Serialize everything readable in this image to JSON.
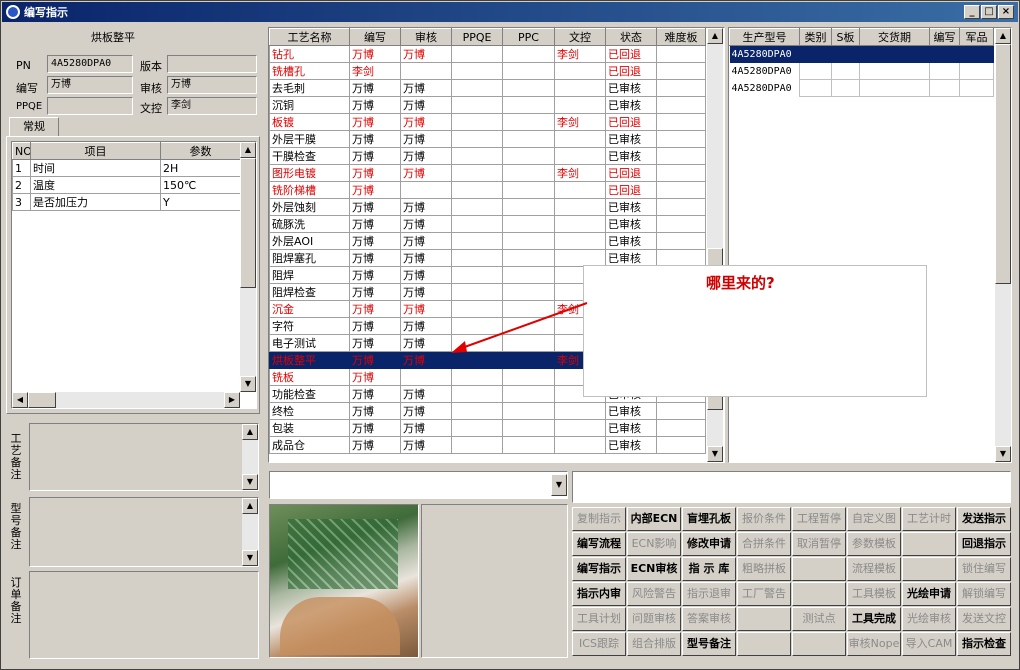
{
  "window": {
    "title": "编写指示",
    "min": "_",
    "max": "□",
    "close": "×"
  },
  "left": {
    "header": "烘板整平",
    "pn_label": "PN",
    "pn": "4A5280DPA0",
    "version_label": "版本",
    "version": "",
    "writer_label": "编写",
    "writer": "万博",
    "reviewer_label": "审核",
    "reviewer": "万博",
    "ppqe_label": "PPQE",
    "ppqe": "",
    "doc_label": "文控",
    "doc": "李剑",
    "tab": "常规",
    "params_headers": [
      "NO",
      "项目",
      "参数"
    ],
    "params": [
      {
        "no": "1",
        "item": "时间",
        "value": "2H"
      },
      {
        "no": "2",
        "item": "温度",
        "value": "150℃"
      },
      {
        "no": "3",
        "item": "是否加压力",
        "value": "Y"
      }
    ],
    "notes": [
      {
        "label": "工艺备注"
      },
      {
        "label": "型号备注"
      },
      {
        "label": "订单备注"
      }
    ]
  },
  "process": {
    "headers": [
      "工艺名称",
      "编写",
      "审核",
      "PPQE",
      "PPC",
      "文控",
      "状态",
      "难度板"
    ],
    "rows": [
      {
        "name": "钻孔",
        "writer": "万博",
        "reviewer": "万博",
        "ppqe": "",
        "ppc": "",
        "doc": "李剑",
        "status": "已回退",
        "hard": "",
        "red": true
      },
      {
        "name": "铣槽孔",
        "writer": "李剑",
        "reviewer": "",
        "ppqe": "",
        "ppc": "",
        "doc": "",
        "status": "已回退",
        "hard": "",
        "red": true
      },
      {
        "name": "去毛刺",
        "writer": "万博",
        "reviewer": "万博",
        "ppqe": "",
        "ppc": "",
        "doc": "",
        "status": "已审核",
        "hard": "",
        "red": false
      },
      {
        "name": "沉铜",
        "writer": "万博",
        "reviewer": "万博",
        "ppqe": "",
        "ppc": "",
        "doc": "",
        "status": "已审核",
        "hard": "",
        "red": false
      },
      {
        "name": "板镀",
        "writer": "万博",
        "reviewer": "万博",
        "ppqe": "",
        "ppc": "",
        "doc": "李剑",
        "status": "已回退",
        "hard": "",
        "red": true
      },
      {
        "name": "外层干膜",
        "writer": "万博",
        "reviewer": "万博",
        "ppqe": "",
        "ppc": "",
        "doc": "",
        "status": "已审核",
        "hard": "",
        "red": false
      },
      {
        "name": "干膜检查",
        "writer": "万博",
        "reviewer": "万博",
        "ppqe": "",
        "ppc": "",
        "doc": "",
        "status": "已审核",
        "hard": "",
        "red": false
      },
      {
        "name": "图形电镀",
        "writer": "万博",
        "reviewer": "万博",
        "ppqe": "",
        "ppc": "",
        "doc": "李剑",
        "status": "已回退",
        "hard": "",
        "red": true
      },
      {
        "name": "铣阶梯槽",
        "writer": "万博",
        "reviewer": "",
        "ppqe": "",
        "ppc": "",
        "doc": "",
        "status": "已回退",
        "hard": "",
        "red": true
      },
      {
        "name": "外层蚀刻",
        "writer": "万博",
        "reviewer": "万博",
        "ppqe": "",
        "ppc": "",
        "doc": "",
        "status": "已审核",
        "hard": "",
        "red": false
      },
      {
        "name": "硫豚洗",
        "writer": "万博",
        "reviewer": "万博",
        "ppqe": "",
        "ppc": "",
        "doc": "",
        "status": "已审核",
        "hard": "",
        "red": false
      },
      {
        "name": "外层AOI",
        "writer": "万博",
        "reviewer": "万博",
        "ppqe": "",
        "ppc": "",
        "doc": "",
        "status": "已审核",
        "hard": "",
        "red": false
      },
      {
        "name": "阻焊塞孔",
        "writer": "万博",
        "reviewer": "万博",
        "ppqe": "",
        "ppc": "",
        "doc": "",
        "status": "已审核",
        "hard": "",
        "red": false
      },
      {
        "name": "阻焊",
        "writer": "万博",
        "reviewer": "万博",
        "ppqe": "",
        "ppc": "",
        "doc": "",
        "status": "",
        "hard": "",
        "red": false
      },
      {
        "name": "阻焊检查",
        "writer": "万博",
        "reviewer": "万博",
        "ppqe": "",
        "ppc": "",
        "doc": "",
        "status": "",
        "hard": "",
        "red": false
      },
      {
        "name": "沉金",
        "writer": "万博",
        "reviewer": "万博",
        "ppqe": "",
        "ppc": "",
        "doc": "李剑",
        "status": "",
        "hard": "",
        "red": true
      },
      {
        "name": "字符",
        "writer": "万博",
        "reviewer": "万博",
        "ppqe": "",
        "ppc": "",
        "doc": "",
        "status": "",
        "hard": "",
        "red": false
      },
      {
        "name": "电子测试",
        "writer": "万博",
        "reviewer": "万博",
        "ppqe": "",
        "ppc": "",
        "doc": "",
        "status": "",
        "hard": "",
        "red": false
      },
      {
        "name": "烘板整平",
        "writer": "万博",
        "reviewer": "万博",
        "ppqe": "",
        "ppc": "",
        "doc": "李剑",
        "status": "",
        "hard": "",
        "red": true,
        "sel": true
      },
      {
        "name": "铣板",
        "writer": "万博",
        "reviewer": "",
        "ppqe": "",
        "ppc": "",
        "doc": "",
        "status": "",
        "hard": "",
        "red": true
      },
      {
        "name": "功能检查",
        "writer": "万博",
        "reviewer": "万博",
        "ppqe": "",
        "ppc": "",
        "doc": "",
        "status": "已审核",
        "hard": "",
        "red": false
      },
      {
        "name": "终检",
        "writer": "万博",
        "reviewer": "万博",
        "ppqe": "",
        "ppc": "",
        "doc": "",
        "status": "已审核",
        "hard": "",
        "red": false
      },
      {
        "name": "包装",
        "writer": "万博",
        "reviewer": "万博",
        "ppqe": "",
        "ppc": "",
        "doc": "",
        "status": "已审核",
        "hard": "",
        "red": false
      },
      {
        "name": "成品仓",
        "writer": "万博",
        "reviewer": "万博",
        "ppqe": "",
        "ppc": "",
        "doc": "",
        "status": "已审核",
        "hard": "",
        "red": false
      }
    ]
  },
  "annotation": {
    "text": "哪里来的?"
  },
  "models": {
    "headers": [
      "生产型号",
      "类别",
      "S板",
      "交货期",
      "编写",
      "军品"
    ],
    "rows": [
      {
        "model": "4A5280DPA0",
        "sel": true
      },
      {
        "model": "4A5280DPA0",
        "sel": false
      },
      {
        "model": "4A5280DPA0",
        "sel": false
      }
    ]
  },
  "buttons": [
    [
      "复制指示",
      "内部ECN",
      "盲埋孔板",
      "报价条件",
      "工程暂停",
      "自定义图",
      "工艺计时",
      "发送指示"
    ],
    [
      "编写流程",
      "ECN影响",
      "修改申请",
      "合拼条件",
      "取消暂停",
      "参数模板",
      "",
      "回退指示"
    ],
    [
      "编写指示",
      "ECN审核",
      "指 示 库",
      "粗略拼板",
      "",
      "流程模板",
      "",
      "锁住编写"
    ],
    [
      "指示内审",
      "风险警告",
      "指示退审",
      "工厂警告",
      "",
      "工具模板",
      "光绘申请",
      "解锁编写"
    ],
    [
      "工具计划",
      "问题审核",
      "答案审核",
      "",
      "测试点",
      "工具完成",
      "光绘审核",
      "发送文控"
    ],
    [
      "ICS跟踪",
      "组合排版",
      "型号备注",
      "",
      "",
      "审核Nope",
      "导入CAM",
      "指示检查"
    ]
  ],
  "buttons_enabled": [
    [
      false,
      true,
      true,
      false,
      false,
      false,
      false,
      true
    ],
    [
      true,
      false,
      true,
      false,
      false,
      false,
      false,
      true
    ],
    [
      true,
      true,
      true,
      false,
      false,
      false,
      false,
      false
    ],
    [
      true,
      false,
      false,
      false,
      false,
      false,
      true,
      false
    ],
    [
      false,
      false,
      false,
      false,
      false,
      true,
      false,
      false
    ],
    [
      false,
      false,
      true,
      false,
      false,
      false,
      false,
      true
    ]
  ]
}
